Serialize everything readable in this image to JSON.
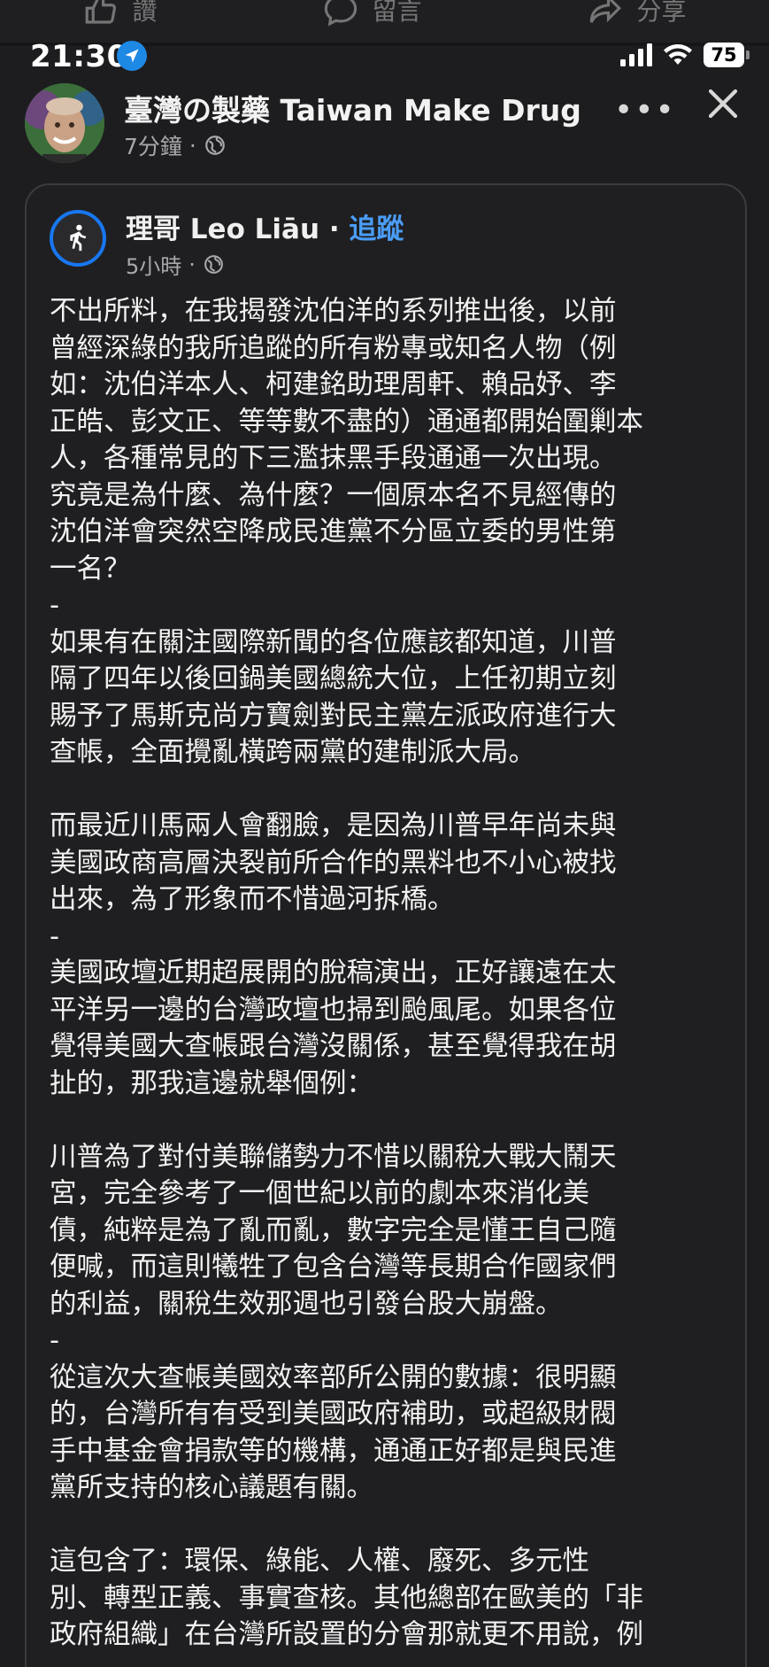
{
  "action_bar": {
    "like_label": "讚",
    "comment_label": "留言",
    "share_label": "分享"
  },
  "status_bar": {
    "time": "21:30",
    "battery": "75"
  },
  "page_header": {
    "name": "臺灣の製藥 Taiwan Make Drug",
    "time_ago": "7分鐘",
    "privacy": "globe-icon",
    "more_label": "•••"
  },
  "shared_post": {
    "author": "理哥 Leo Liāu",
    "separator": "·",
    "follow_label": "追蹤",
    "time_ago": "5小時",
    "body_lines": [
      "不出所料，在我揭發沈伯洋的系列推出後，以前",
      "曾經深綠的我所追蹤的所有粉專或知名人物（例",
      "如：沈伯洋本人、柯建銘助理周軒、賴品妤、李",
      "正皓、彭文正、等等數不盡的）通通都開始圍剿本",
      "人，各種常見的下三濫抹黑手段通通一次出現。",
      "究竟是為什麼、為什麼？一個原本名不見經傳的",
      "沈伯洋會突然空降成民進黨不分區立委的男性第",
      "一名？",
      "-",
      "如果有在關注國際新聞的各位應該都知道，川普",
      "隔了四年以後回鍋美國總統大位，上任初期立刻",
      "賜予了馬斯克尚方寶劍對民主黨左派政府進行大",
      "查帳，全面攪亂橫跨兩黨的建制派大局。",
      "",
      "而最近川馬兩人會翻臉，是因為川普早年尚未與",
      "美國政商高層決裂前所合作的黑料也不小心被找",
      "出來，為了形象而不惜過河拆橋。",
      "-",
      "美國政壇近期超展開的脫稿演出，正好讓遠在太",
      "平洋另一邊的台灣政壇也掃到颱風尾。如果各位",
      "覺得美國大查帳跟台灣沒關係，甚至覺得我在胡",
      "扯的，那我這邊就舉個例：",
      "",
      "川普為了對付美聯儲勢力不惜以關稅大戰大鬧天",
      "宮，完全參考了一個世紀以前的劇本來消化美",
      "債，純粹是為了亂而亂，數字完全是懂王自己隨",
      "便喊，而這則犧牲了包含台灣等長期合作國家們",
      "的利益，關稅生效那週也引發台股大崩盤。",
      "-",
      "從這次大查帳美國效率部所公開的數據：很明顯",
      "的，台灣所有有受到美國政府補助，或超級財閥",
      "手中基金會捐款等的機構，通通正好都是與民進",
      "黨所支持的核心議題有關。",
      "",
      "這包含了：環保、綠能、人權、廢死、多元性",
      "別、轉型正義、事實查核。其他總部在歐美的「非",
      "政府組織」在台灣所設置的分會那就更不用說，例"
    ]
  }
}
